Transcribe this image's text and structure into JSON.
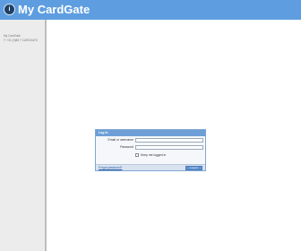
{
  "header": {
    "brand_my": "My",
    "brand_name": "CardGate",
    "logo_glyph": "i"
  },
  "sidebar": {
    "contact_line1": "My CardGate",
    "contact_line2": "T: +31 (0)88 7 CARDGATE"
  },
  "login": {
    "title": "Log in",
    "username_label": "Email or username",
    "password_label": "Password",
    "keep_logged_in_label": "Keep me logged in",
    "forgot_link": "Forgot password?",
    "login_button": "Log in"
  },
  "colors": {
    "header": "#5e9ee0",
    "sidebar": "#ececec",
    "accent": "#6d9fd6"
  },
  "icons": [
    "logo-icon"
  ]
}
